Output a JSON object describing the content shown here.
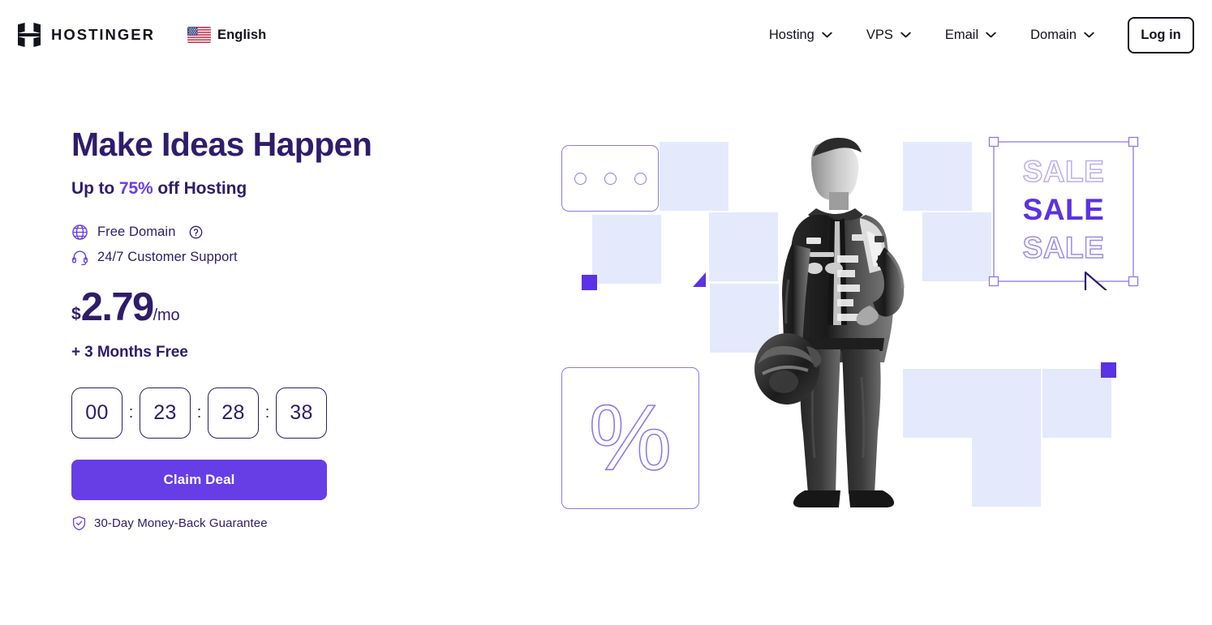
{
  "header": {
    "logo_text": "HOSTINGER",
    "logo_icon": "hostinger-h-logo",
    "language": {
      "flag_icon": "us-flag-icon",
      "label": "English"
    },
    "nav_items": [
      {
        "label": "Hosting",
        "icon": "chevron-down-icon"
      },
      {
        "label": "VPS",
        "icon": "chevron-down-icon"
      },
      {
        "label": "Email",
        "icon": "chevron-down-icon"
      },
      {
        "label": "Domain",
        "icon": "chevron-down-icon"
      }
    ],
    "login_label": "Log in"
  },
  "hero": {
    "headline": "Make Ideas Happen",
    "subhead_prefix": "Up to ",
    "subhead_accent": "75%",
    "subhead_suffix": " off Hosting",
    "features": [
      {
        "icon": "globe-icon",
        "label": "Free Domain",
        "help_icon": "question-mark-circle-icon"
      },
      {
        "icon": "headset-icon",
        "label": "24/7 Customer Support"
      }
    ],
    "price": {
      "currency": "$",
      "value": "2.79",
      "period": "/mo"
    },
    "bonus": "+ 3 Months Free",
    "countdown": {
      "separator": ":",
      "cells": [
        "00",
        "23",
        "28",
        "38"
      ]
    },
    "cta_label": "Claim Deal",
    "guarantee": {
      "icon": "shield-check-icon",
      "label": "30-Day Money-Back Guarantee"
    }
  },
  "illustration": {
    "sale_text_top": "SALE",
    "sale_text_mid": "SALE",
    "sale_text_bottom": "SALE",
    "percent_symbol": "%",
    "cursor_icon": "mouse-pointer-icon",
    "photo_subject": "racing-driver-holding-helmet"
  },
  "colors": {
    "brand_purple": "#673de6",
    "deep_purple": "#2f1c6a",
    "accent_square": "#5b32e4",
    "light_lavender": "#e4eafc",
    "outline_violet": "#8c79e8",
    "text_dark": "#12141d"
  }
}
